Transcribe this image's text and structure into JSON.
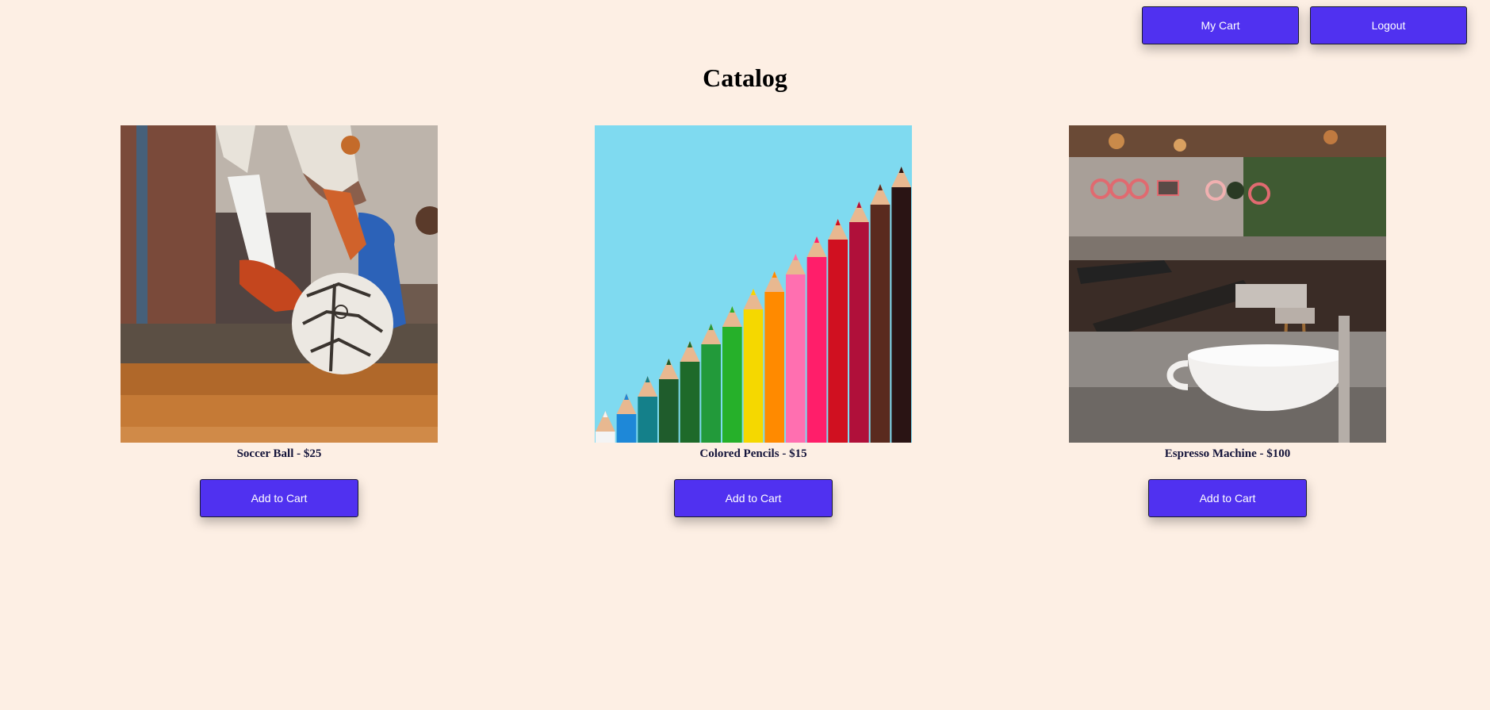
{
  "header": {
    "cart_label": "My Cart",
    "logout_label": "Logout"
  },
  "page": {
    "title": "Catalog"
  },
  "products": [
    {
      "name": "Soccer Ball",
      "separator": " - ",
      "price": "$25",
      "button_label": "Add to Cart",
      "image": "soccer-ball-photo"
    },
    {
      "name": "Colored Pencils",
      "separator": " - ",
      "price": "$15",
      "button_label": "Add to Cart",
      "image": "colored-pencils-photo"
    },
    {
      "name": "Espresso Machine",
      "separator": " - ",
      "price": "$100",
      "button_label": "Add to Cart",
      "image": "espresso-machine-photo"
    }
  ],
  "colors": {
    "background": "#fdefe4",
    "button": "#5031f0",
    "button_text": "#ffffff",
    "caption_text": "#14143a"
  }
}
